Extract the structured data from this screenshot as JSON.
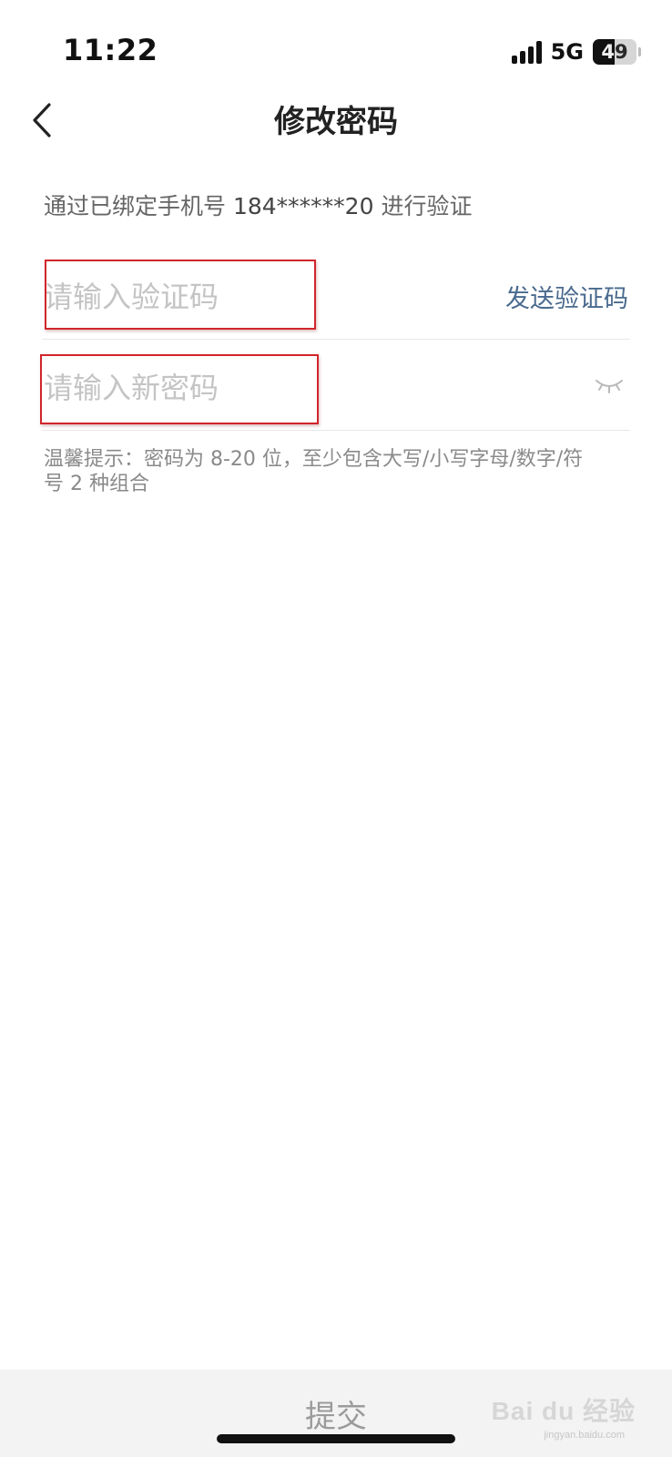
{
  "status_bar": {
    "time": "11:22",
    "network": "5G",
    "battery_level": "49"
  },
  "nav": {
    "title": "修改密码"
  },
  "verify_hint": {
    "prefix": "通过已绑定手机号",
    "phone": "184******20",
    "suffix": "进行验证"
  },
  "code_field": {
    "placeholder": "请输入验证码",
    "value": "",
    "send_label": "发送验证码"
  },
  "password_field": {
    "placeholder": "请输入新密码",
    "value": ""
  },
  "tip": {
    "text": "温馨提示：密码为 8-20 位，至少包含大写/小写字母/数字/符号 2 种组合"
  },
  "submit": {
    "label": "提交"
  },
  "watermark": {
    "brand": "Bai du 经验",
    "url": "jingyan.baidu.com"
  },
  "colors": {
    "accent_link": "#4a6a8e",
    "highlight_box": "#d0262b",
    "submit_bar": "#f3f3f3"
  },
  "icons": {
    "back": "chevron-left-icon",
    "eye_toggle": "eye-closed-icon",
    "signal": "signal-bars-icon",
    "battery": "battery-icon"
  }
}
